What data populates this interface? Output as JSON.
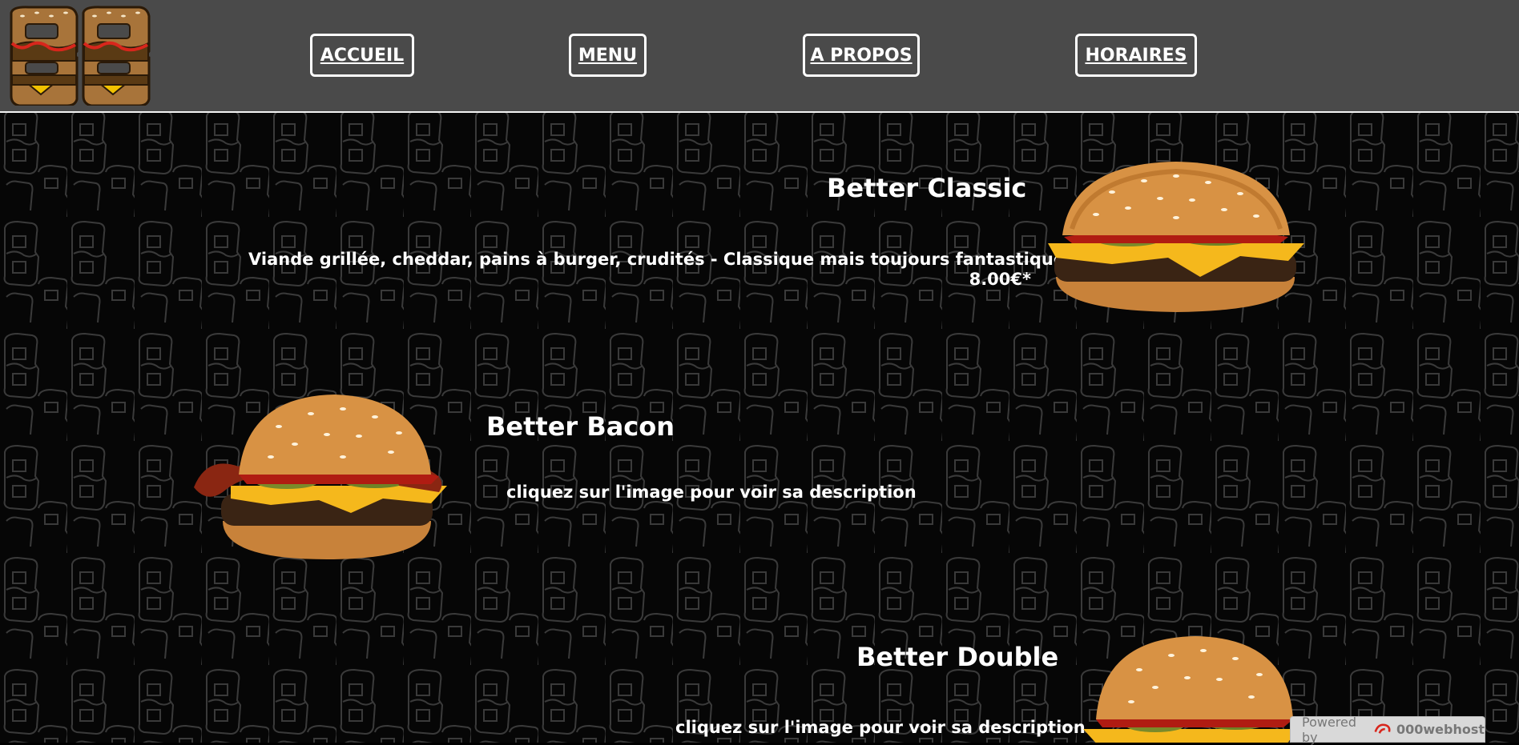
{
  "nav": {
    "items": [
      {
        "label": "ACCUEIL"
      },
      {
        "label": "MENU"
      },
      {
        "label": "A PROPOS"
      },
      {
        "label": "HORAIRES"
      }
    ]
  },
  "menu": {
    "items": [
      {
        "title": "Better Classic",
        "description": "Viande grillée, cheddar, pains à burger, crudités - Classique mais toujours fantastique.",
        "price": "8.00€*"
      },
      {
        "title": "Better Bacon",
        "description": "cliquez sur l'image pour voir sa description"
      },
      {
        "title": "Better Double",
        "description": "cliquez sur l'image pour voir sa description"
      }
    ]
  },
  "footer_badge": {
    "prefix": "Powered by",
    "brand": "000webhost"
  },
  "colors": {
    "header_bg": "#4a4a4a",
    "page_bg": "#060606",
    "pattern_stroke": "#3a3a3a",
    "logo_bun": "#a8743a",
    "logo_meat": "#5a3a14",
    "logo_cheese": "#f2c200",
    "logo_sauce": "#d8261c"
  }
}
